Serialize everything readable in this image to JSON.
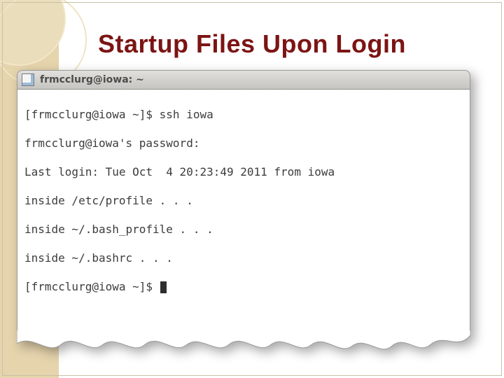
{
  "slide": {
    "title": "Startup Files Upon Login"
  },
  "terminal": {
    "window_title": "frmcclurg@iowa: ~",
    "lines": [
      "[frmcclurg@iowa ~]$ ssh iowa",
      "frmcclurg@iowa's password:",
      "Last login: Tue Oct  4 20:23:49 2011 from iowa",
      "inside /etc/profile . . .",
      "inside ~/.bash_profile . . .",
      "inside ~/.bashrc . . .",
      "[frmcclurg@iowa ~]$ "
    ]
  }
}
